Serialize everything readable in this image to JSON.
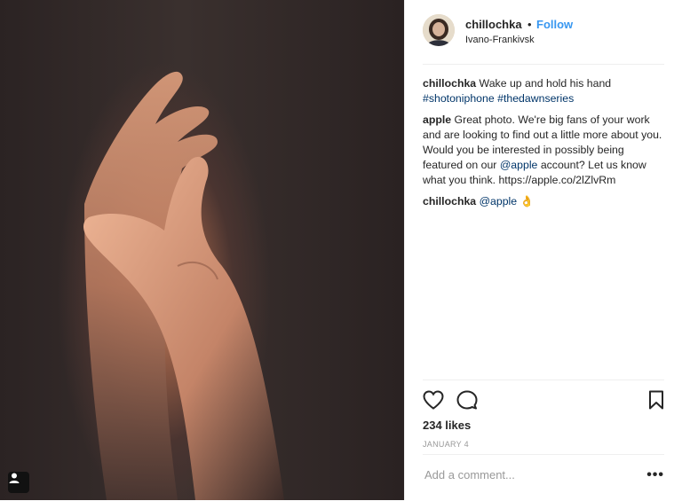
{
  "post": {
    "image_alt": "Two hands touching in warm light",
    "author": {
      "username": "chillochka",
      "separator": "•",
      "follow_label": "Follow",
      "location": "Ivano-Frankivsk"
    },
    "comments": [
      {
        "user": "chillochka",
        "segments": [
          {
            "text": " Wake up and hold his hand ",
            "link": false
          },
          {
            "text": "#shotoniphone",
            "link": true
          },
          {
            "text": " ",
            "link": false
          },
          {
            "text": "#thedawnseries",
            "link": true
          }
        ]
      },
      {
        "user": "apple",
        "segments": [
          {
            "text": " Great photo. We're big fans of your work and are looking to find out a little more about you. Would you be interested in possibly being featured on our ",
            "link": false
          },
          {
            "text": "@apple",
            "link": true
          },
          {
            "text": " account? Let us know what you think. https://apple.co/2lZlvRm",
            "link": false
          }
        ]
      },
      {
        "user": "chillochka",
        "segments": [
          {
            "text": " ",
            "link": false
          },
          {
            "text": "@apple",
            "link": true
          },
          {
            "text": " 👌",
            "link": false
          }
        ]
      }
    ],
    "actions": {
      "like_icon": "heart-icon",
      "comment_icon": "comment-icon",
      "save_icon": "bookmark-icon"
    },
    "likes": "234 likes",
    "date": "JANUARY 4",
    "add_comment": {
      "placeholder": "Add a comment...",
      "more": "•••"
    }
  }
}
